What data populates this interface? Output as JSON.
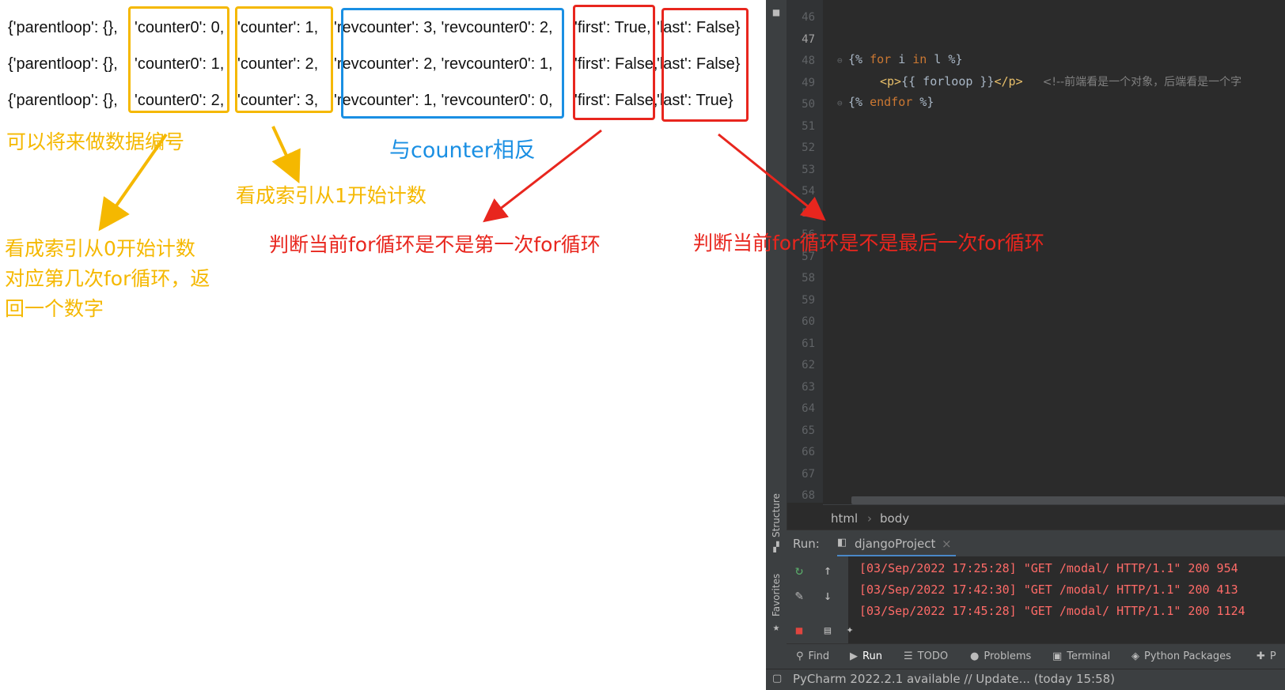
{
  "browser": {
    "rows": [
      {
        "parentloop": "{'parentloop': {},",
        "counter0": "'counter0': 0,",
        "counter": "'counter': 1,",
        "rev": "'revcounter': 3, 'revcounter0': 2,",
        "first": "'first': True,",
        "last": "'last': False}"
      },
      {
        "parentloop": "{'parentloop': {},",
        "counter0": "'counter0': 1,",
        "counter": "'counter': 2,",
        "rev": "'revcounter': 2, 'revcounter0': 1,",
        "first": "'first': False,",
        "last": "'last': False}"
      },
      {
        "parentloop": "{'parentloop': {},",
        "counter0": "'counter0': 2,",
        "counter": "'counter': 3,",
        "rev": "'revcounter': 1, 'revcounter0': 0,",
        "first": "'first': False,",
        "last": "'last': True}"
      }
    ],
    "annotations": {
      "numbering": "可以将来做数据编号",
      "index_from_one": "看成索引从1开始计数",
      "rev_opposite": "与counter相反",
      "index_from_zero_1": "看成索引从0开始计数",
      "index_from_zero_2": "对应第几次for循环，返",
      "index_from_zero_3": "回一个数字",
      "first_desc": "判断当前for循环是不是第一次for循环",
      "last_desc": "判断当前for循环是不是最后一次for循环"
    },
    "colors": {
      "yellow": "#f5b800",
      "blue": "#1a8fe3",
      "red": "#e8261e"
    }
  },
  "ide": {
    "line_numbers": [
      "46",
      "47",
      "48",
      "49",
      "50",
      "51",
      "52",
      "53",
      "54",
      "55",
      "56",
      "57",
      "58",
      "59",
      "60",
      "61",
      "62",
      "63",
      "64",
      "65",
      "66",
      "67",
      "68"
    ],
    "code": {
      "l48_a": "{%",
      "l48_for": "for",
      "l48_b": " i  ",
      "l48_in": "in",
      "l48_c": " l %}",
      "l49_open": "<p>",
      "l49_tpl": "{{ forloop }}",
      "l49_close": "</p>",
      "l49_cmt": "<!--前端看是一个对象，后端看是一个字",
      "l50_a": "{%",
      "l50_endfor": "endfor",
      "l50_b": " %}"
    },
    "breadcrumb": {
      "first": "html",
      "sep": "›",
      "second": "body"
    },
    "run": {
      "label": "Run:",
      "tab": "djangoProject",
      "close": "×"
    },
    "logs": [
      "[03/Sep/2022 17:25:28] \"GET /modal/ HTTP/1.1\" 200 954",
      "[03/Sep/2022 17:42:30] \"GET /modal/ HTTP/1.1\" 200 413",
      "[03/Sep/2022 17:45:28] \"GET /modal/ HTTP/1.1\" 200 1124"
    ],
    "side_labels": {
      "structure": "Structure",
      "favorites": "Favorites"
    },
    "bottom_tabs": [
      {
        "icon": "search-icon",
        "label": "Find"
      },
      {
        "icon": "run-icon",
        "label": "Run"
      },
      {
        "icon": "todo-icon",
        "label": "TODO"
      },
      {
        "icon": "problems-icon",
        "label": "Problems"
      },
      {
        "icon": "terminal-icon",
        "label": "Terminal"
      },
      {
        "icon": "python-packages-icon",
        "label": "Python Packages"
      },
      {
        "icon": "puzzle-icon",
        "label": "P"
      }
    ],
    "status": "PyCharm 2022.2.1 available // Update... (today 15:58)"
  }
}
